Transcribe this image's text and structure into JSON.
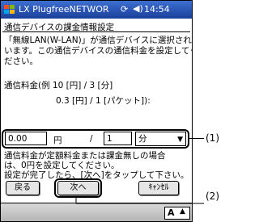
{
  "titlebar": {
    "app_title": "LX PlugfreeNETWOR",
    "time": "14:54",
    "sync_icon": "sync-icon",
    "speaker_icon": "speaker-icon",
    "start_icon": "windows-flag-icon"
  },
  "heading": "通信デバイスの課金情報設定",
  "description": {
    "line1": "「無線LAN(W-LAN)」が通信デバイスに選択されて",
    "line2": "います。この通信デバイスの通信料金を設定してく",
    "line3": "ださい。"
  },
  "rate_example": {
    "line1": "通信料金(例  10 [円] / 3 [分]",
    "line2": "0.3 [円] / 1 [パケット]):"
  },
  "rate_form": {
    "amount_value": "0.00",
    "amount_unit": "円",
    "separator": "/",
    "quantity_value": "1",
    "unit_selected": "分"
  },
  "note": {
    "line1": "通信料金が定額料金または課金無しの場合",
    "line2": "は、0円を設定してください。",
    "line3": "設定が完了したら、[次へ]をタップして下さい。"
  },
  "buttons": {
    "back": "戻る",
    "next": "次へ",
    "cancel": "ｷｬﾝｾﾙ"
  },
  "input_panel": {
    "label": "A"
  },
  "callouts": {
    "c1": "(1)",
    "c2": "(2)"
  }
}
